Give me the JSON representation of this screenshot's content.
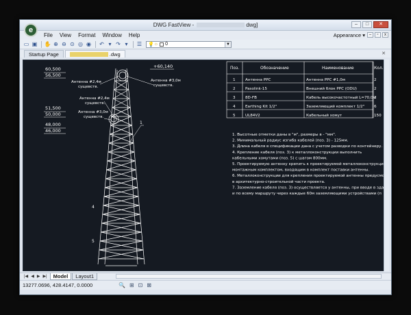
{
  "app": {
    "title_prefix": "DWG FastView - ",
    "title_suffix": "dwg]",
    "logo_letter": "e"
  },
  "menu": [
    "File",
    "View",
    "Format",
    "Window",
    "Help"
  ],
  "appearance_label": "Appearance",
  "toolbar": {
    "layer_value": "0"
  },
  "tabs": {
    "startup": "Startup Page",
    "drawing_suffix": ".dwg"
  },
  "drawing": {
    "elevations": [
      {
        "label": "+60,140",
        "side": "right"
      },
      {
        "label": "60,500",
        "side": "left"
      },
      {
        "label": "56,500",
        "side": "left"
      },
      {
        "label": "51,500",
        "side": "left"
      },
      {
        "label": "50,000",
        "side": "left"
      },
      {
        "label": "48,000",
        "side": "left"
      },
      {
        "label": "46,000",
        "side": "left"
      }
    ],
    "antenna_labels": [
      {
        "line1": "Антенна #2,4м",
        "line2": "сущевств."
      },
      {
        "line1": "Антенна #3,0м",
        "line2": "сущевств."
      },
      {
        "line1": "Антенна #2,4м",
        "line2": "сущевств."
      },
      {
        "line1": "Антенна #3,0м",
        "line2": "сущевств."
      }
    ],
    "marker_numbers": [
      "1",
      "2",
      "3",
      "4",
      "5"
    ],
    "table": {
      "headers": [
        "Поз.",
        "Обозначение",
        "Наименование",
        "Кол."
      ],
      "rows": [
        [
          "1",
          "Антенна РРС",
          "Антенна РРС #1,0м",
          "2"
        ],
        [
          "2",
          "Pasolink-15",
          "Внешний блок РРС (ODU)",
          "2"
        ],
        [
          "3",
          "8D-FB",
          "Кабель высокочастотный L=70,0м",
          "2"
        ],
        [
          "4",
          "Earthing Kit 1/2\"",
          "Заземляющий комплект 1/2\"",
          "6"
        ],
        [
          "5",
          "UL84V2",
          "Кабельный хомут",
          "150"
        ]
      ]
    },
    "notes": [
      "1. Высотные отметки даны в \"м\", размеры в - \"мм\".",
      "2. Минимальный радиус изгиба кабелей (поз. 3) - 125мм.",
      "3. Длина кабеля в спецификации дана с учетом разводки по контейнеру.",
      "4. Крепление кабеля (поз. 3) к металлоконструкции выполнить",
      "   кабельными хомутами (поз. 5) с шагом 800мм.",
      "5. Проектируемую антенну крепить к проектируемой металлоконструкции",
      "   монтажным комплектом, входящим в комплект поставки антенны.",
      "6. Металлоконструкции для крепления проектируемой антенны предусмот",
      "   в архитектурно-строительной части проекта.",
      "7. Заземление кабеля (поз. 3) осуществляется у антенны, при вводе в здани",
      "   и по всему маршруту через каждые 60м заземляющими устройствами (п"
    ]
  },
  "layout_tabs": [
    "Model",
    "Layout1"
  ],
  "status": {
    "coordinates": "13277.0696, 428.4147, 0.0000"
  },
  "colors": {
    "canvas_bg": "#151a22",
    "line": "#ffffff",
    "logo": "#2d5e35"
  }
}
